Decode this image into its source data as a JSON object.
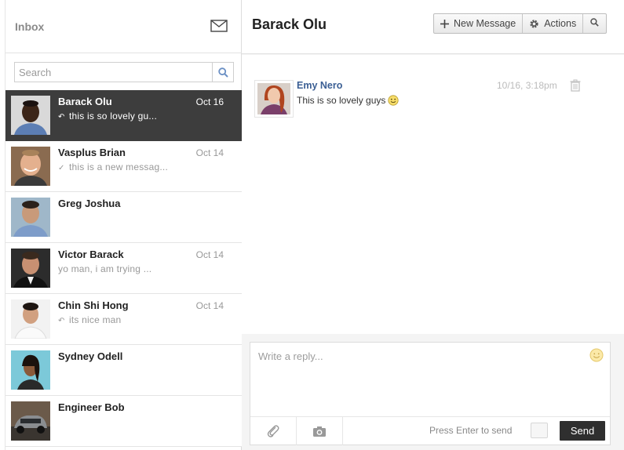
{
  "sidebar": {
    "title": "Inbox",
    "search_placeholder": "Search",
    "conversations": [
      {
        "name": "Barack Olu",
        "date": "Oct 16",
        "preview": "this is so lovely gu...",
        "status_icon": "reply-icon",
        "active": true
      },
      {
        "name": "Vasplus Brian",
        "date": "Oct 14",
        "preview": "this is a new messag...",
        "status_icon": "check-icon",
        "active": false
      },
      {
        "name": "Greg Joshua",
        "date": "",
        "preview": "",
        "status_icon": "",
        "active": false
      },
      {
        "name": "Victor Barack",
        "date": "Oct 14",
        "preview": "yo man, i am trying ...",
        "status_icon": "",
        "active": false
      },
      {
        "name": "Chin Shi Hong",
        "date": "Oct 14",
        "preview": "its nice man",
        "status_icon": "reply-icon",
        "active": false
      },
      {
        "name": "Sydney Odell",
        "date": "",
        "preview": "",
        "status_icon": "",
        "active": false
      },
      {
        "name": "Engineer Bob",
        "date": "",
        "preview": "",
        "status_icon": "",
        "active": false
      }
    ]
  },
  "conversation": {
    "title": "Barack Olu",
    "new_message_label": "New Message",
    "actions_label": "Actions",
    "messages": [
      {
        "author": "Emy Nero",
        "time": "10/16, 3:18pm",
        "text": "This is so lovely guys"
      }
    ]
  },
  "reply": {
    "placeholder": "Write a reply...",
    "enter_label": "Press Enter to send",
    "send_label": "Send"
  },
  "colors": {
    "active_row": "#3d3d3d",
    "author_link": "#3b5f94",
    "send_button": "#2f2f2f"
  }
}
